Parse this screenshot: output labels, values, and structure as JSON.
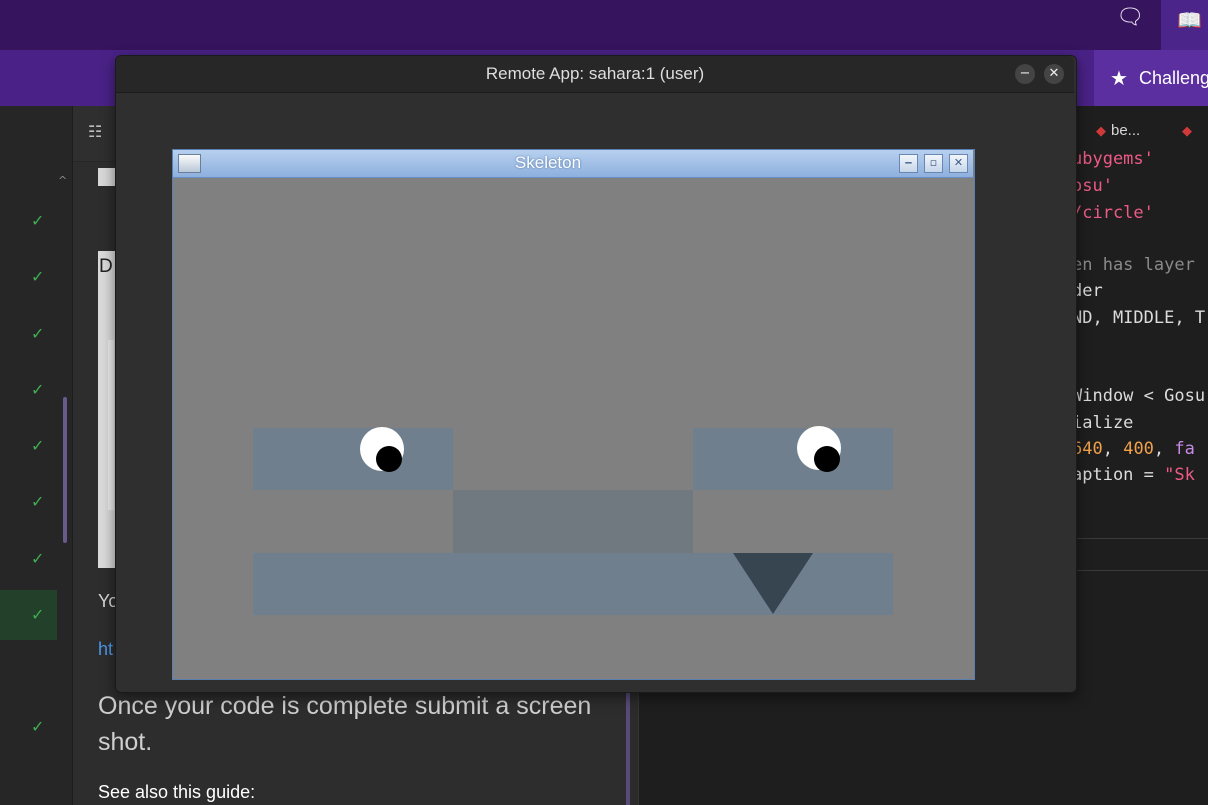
{
  "top_nav": {
    "chat_icon": "chat-icon",
    "book_icon": "book-icon",
    "challenge_tab_label": "Challeng"
  },
  "left_nav": {
    "completed_items": 9,
    "check_glyph": "✓"
  },
  "content": {
    "image_letter": "D",
    "text_fragment": "Yo",
    "link_fragment": "ht",
    "paragraph": "Once your code is complete submit a screen shot.",
    "guide_text": "See also this guide:"
  },
  "editor": {
    "tabs": [
      "be...",
      ""
    ],
    "code_lines": [
      {
        "text": "ubygems'",
        "kind": "str"
      },
      {
        "text": "osu'",
        "kind": "str"
      },
      {
        "text": "/circle'",
        "kind": "str"
      },
      {
        "text": "",
        "kind": "def"
      },
      {
        "text": "en has layer",
        "kind": "com"
      },
      {
        "text": "der",
        "kind": "def"
      },
      {
        "text": "ND, MIDDLE, T",
        "kind": "def"
      },
      {
        "text": "",
        "kind": "def"
      },
      {
        "text": "",
        "kind": "def"
      },
      {
        "text": "Window < Gosu",
        "kind": "def"
      },
      {
        "text": "ialize",
        "kind": "def"
      },
      {
        "text": "",
        "kind": "def"
      },
      {
        "text": "aption = ",
        "kind": "def"
      }
    ],
    "line12_nums": [
      "640",
      "400"
    ],
    "line12_kw": "fa",
    "line13_str": "\"Sk"
  },
  "remote_window": {
    "title": "Remote App: sahara:1 (user)",
    "minimize": "−",
    "close": "✕"
  },
  "skeleton_window": {
    "title": "Skeleton",
    "btn_min": "‒",
    "btn_max": "▫",
    "btn_close": "✕",
    "colors": {
      "background": "#808080",
      "block": "#707f8d",
      "nose": "#707880",
      "beak": "#36454f"
    }
  }
}
